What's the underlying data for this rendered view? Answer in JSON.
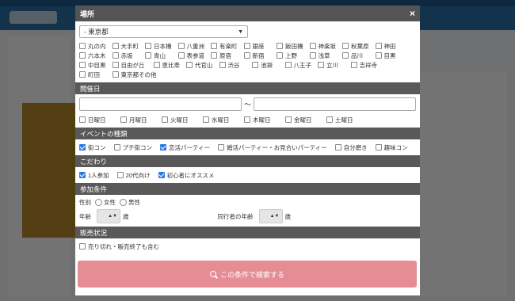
{
  "modal": {
    "location_title": "場所",
    "close_label": "×",
    "prefecture": "- 東京都",
    "areas": [
      "丸の内",
      "大手町",
      "日本橋",
      "八重洲",
      "有楽町",
      "銀座",
      "飯田橋",
      "神楽坂",
      "秋葉原",
      "神田",
      "六本木",
      "赤坂",
      "青山",
      "表参道",
      "原宿",
      "新宿",
      "上野",
      "浅草",
      "品川",
      "目黒",
      "中目黒",
      "自由が丘",
      "恵比寿",
      "代官山",
      "渋谷",
      "池袋",
      "八王子",
      "立川",
      "吉祥寺",
      "町田",
      "東京都その他"
    ],
    "date_section": "開催日",
    "date_separator": "～",
    "weekdays": [
      "日曜日",
      "月曜日",
      "火曜日",
      "水曜日",
      "木曜日",
      "金曜日",
      "土曜日"
    ],
    "event_section": "イベントの種類",
    "event_types": [
      {
        "label": "街コン",
        "checked": true
      },
      {
        "label": "プチ街コン",
        "checked": false
      },
      {
        "label": "恋活パーティー",
        "checked": true
      },
      {
        "label": "婚活パーティー・お見合いパーティー",
        "checked": false
      },
      {
        "label": "自分磨き",
        "checked": false
      },
      {
        "label": "趣味コン",
        "checked": false
      }
    ],
    "kodawari_section": "こだわり",
    "kodawari": [
      {
        "label": "1人参加",
        "checked": true
      },
      {
        "label": "20代向け",
        "checked": false
      },
      {
        "label": "初心者にオススメ",
        "checked": true
      }
    ],
    "conditions_section": "参加条件",
    "gender_label": "性別",
    "gender_options": [
      "女性",
      "男性"
    ],
    "age_label": "年齢",
    "age_unit": "歳",
    "companion_age_label": "同行者の年齢",
    "sales_section": "販売状況",
    "include_sold_out": "売り切れ・販売終了も含む",
    "search_button": "この条件で検索する"
  }
}
